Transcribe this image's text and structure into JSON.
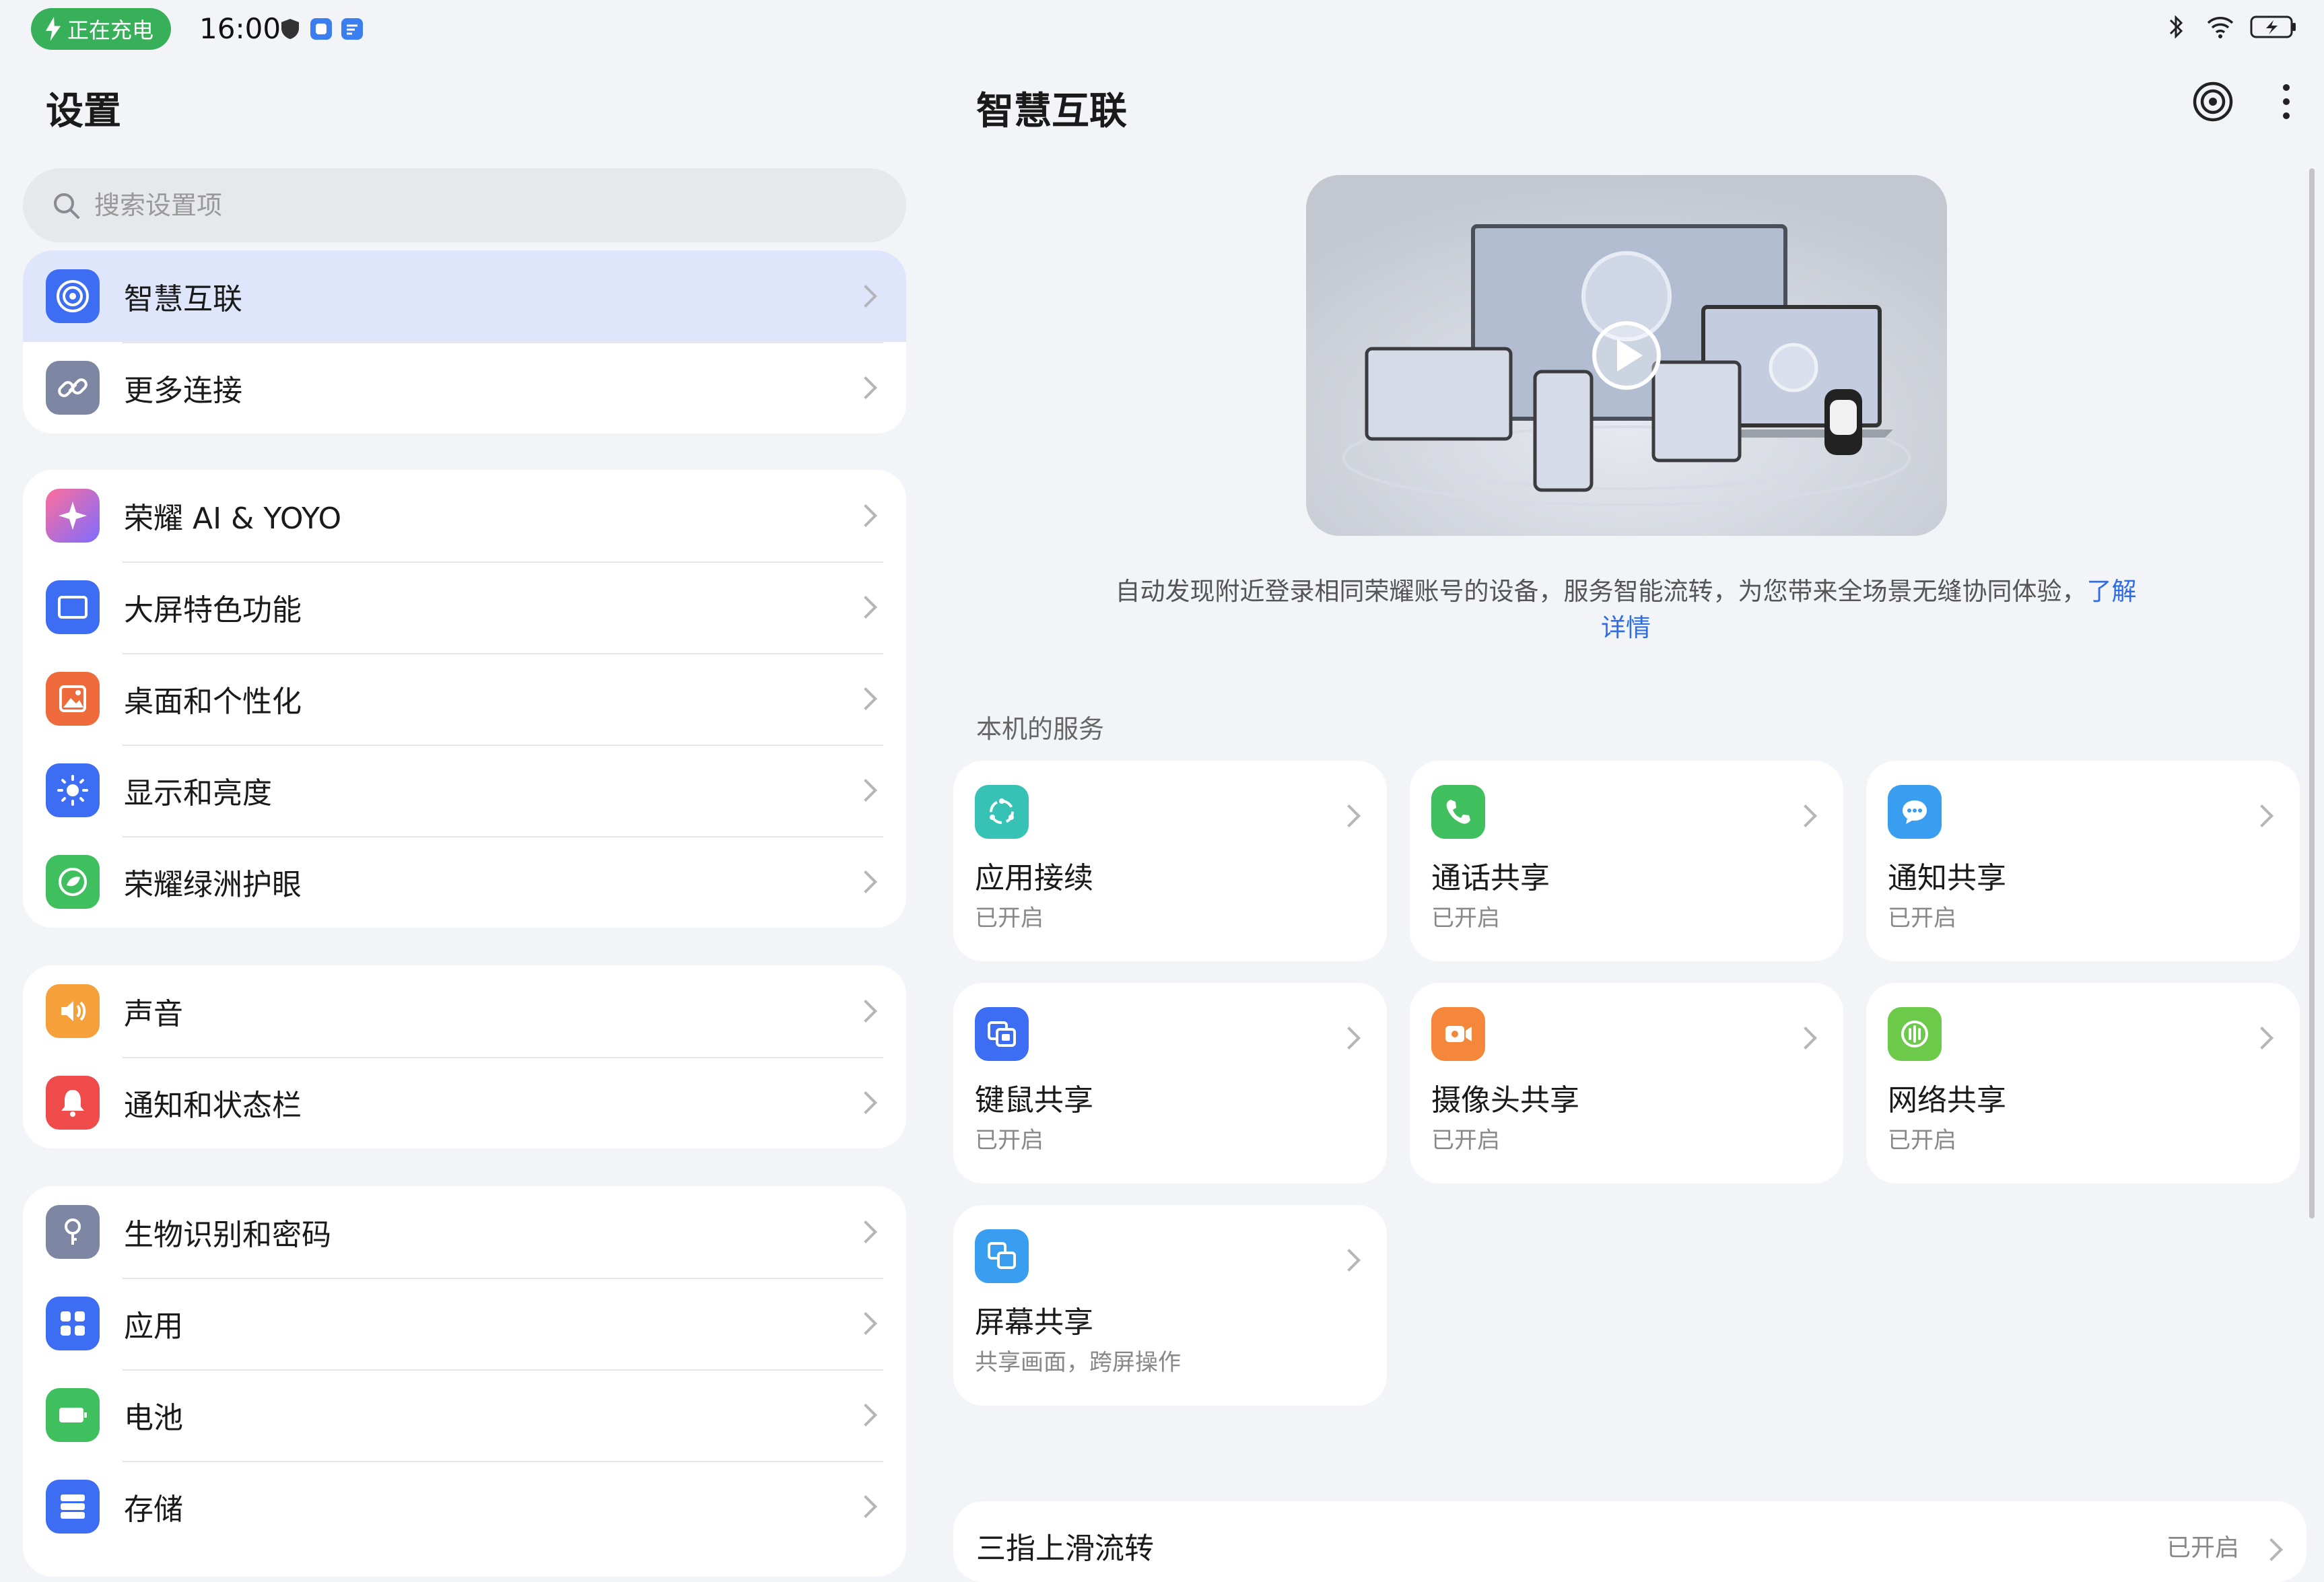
{
  "status_bar": {
    "charging_label": "正在充电",
    "time": "16:00"
  },
  "left": {
    "title": "设置",
    "search_placeholder": "搜索设置项",
    "groups": [
      [
        {
          "label": "智慧互联",
          "icon": "smart-connect-icon",
          "color": "#3d6df2"
        },
        {
          "label": "更多连接",
          "icon": "link-icon",
          "color": "#7d86a3"
        }
      ],
      [
        {
          "label": "荣耀 AI & YOYO",
          "icon": "ai-sparkle-icon",
          "color": "#ff6f9c"
        },
        {
          "label": "大屏特色功能",
          "icon": "large-screen-icon",
          "color": "#3d6df2"
        },
        {
          "label": "桌面和个性化",
          "icon": "wallpaper-icon",
          "color": "#f06b3c"
        },
        {
          "label": "显示和亮度",
          "icon": "brightness-icon",
          "color": "#3d6df2"
        },
        {
          "label": "荣耀绿洲护眼",
          "icon": "eye-care-icon",
          "color": "#3fbf5e"
        }
      ],
      [
        {
          "label": "声音",
          "icon": "speaker-icon",
          "color": "#f5a03a"
        },
        {
          "label": "通知和状态栏",
          "icon": "bell-icon",
          "color": "#ef4b4b"
        }
      ],
      [
        {
          "label": "生物识别和密码",
          "icon": "key-icon",
          "color": "#7d86a3"
        },
        {
          "label": "应用",
          "icon": "apps-grid-icon",
          "color": "#3d6df2"
        },
        {
          "label": "电池",
          "icon": "battery-icon",
          "color": "#3fbf5e"
        },
        {
          "label": "存储",
          "icon": "storage-icon",
          "color": "#3d6df2"
        }
      ]
    ]
  },
  "right": {
    "title": "智慧互联",
    "description": "自动发现附近登录相同荣耀账号的设备，服务智能流转，为您带来全场景无缝协同体验，",
    "learn_more": "了解详情",
    "section_label": "本机的服务",
    "cards": [
      {
        "title": "应用接续",
        "subtitle": "已开启",
        "icon": "app-relay-icon",
        "color": "#36c2b4"
      },
      {
        "title": "通话共享",
        "subtitle": "已开启",
        "icon": "phone-icon",
        "color": "#3fbf5e"
      },
      {
        "title": "通知共享",
        "subtitle": "已开启",
        "icon": "message-bubble-icon",
        "color": "#3a9ef0"
      },
      {
        "title": "键鼠共享",
        "subtitle": "已开启",
        "icon": "keyboard-mouse-icon",
        "color": "#3d6df2"
      },
      {
        "title": "摄像头共享",
        "subtitle": "已开启",
        "icon": "camera-icon",
        "color": "#f5873a"
      },
      {
        "title": "网络共享",
        "subtitle": "已开启",
        "icon": "network-share-icon",
        "color": "#6cc94a"
      },
      {
        "title": "屏幕共享",
        "subtitle": "共享画面，跨屏操作",
        "icon": "screen-share-icon",
        "color": "#3a9ef0"
      }
    ],
    "bottom_item": {
      "title": "三指上滑流转",
      "subtitle": "已开启"
    }
  }
}
